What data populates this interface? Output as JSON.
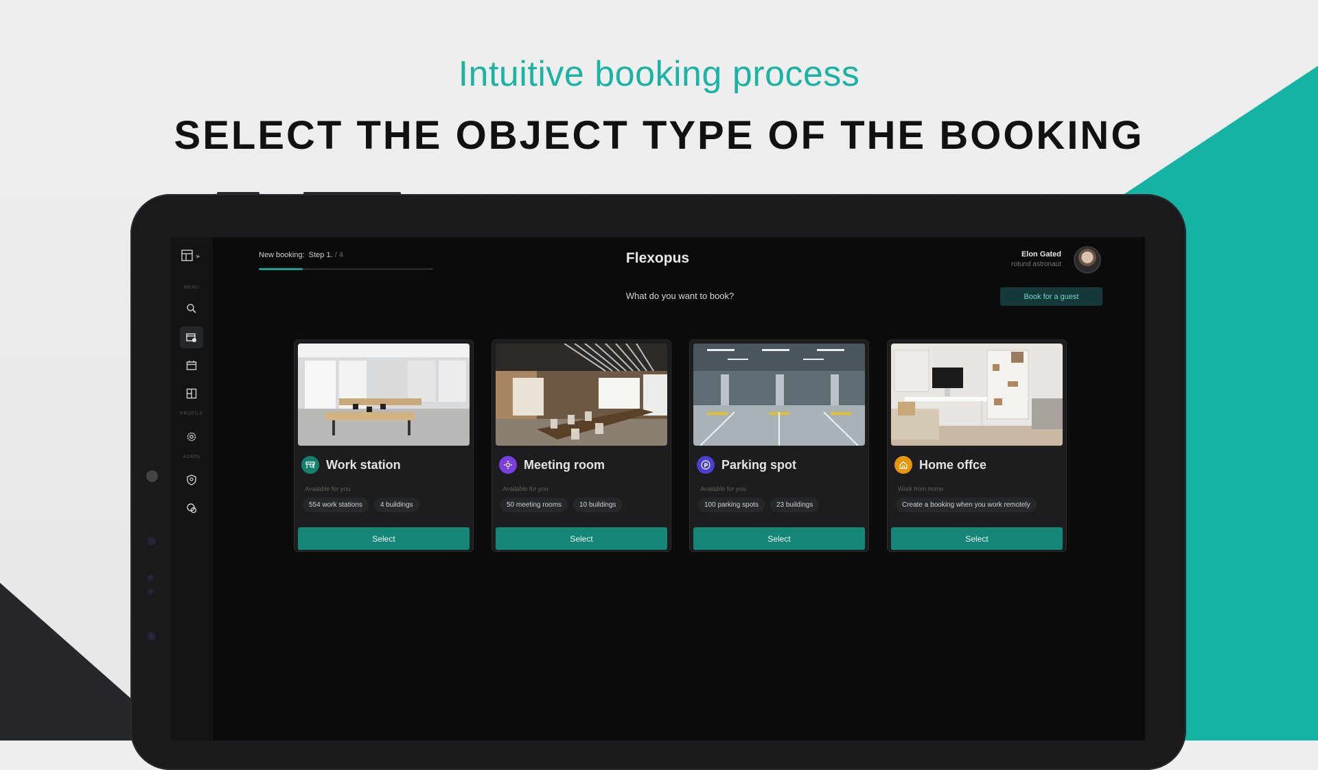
{
  "colors": {
    "accent": "#14b3a3",
    "button": "#168679",
    "background": "#0b0b0c"
  },
  "hero": {
    "subtitle": "Intuitive booking process",
    "title": "SELECT THE OBJECT TYPE OF THE BOOKING"
  },
  "app": {
    "brand": "Flexopus",
    "step": {
      "label": "New booking:",
      "current": "Step 1.",
      "separator": "/",
      "total": "4",
      "progress": 0.25
    },
    "user": {
      "name": "Elon Gated",
      "role": "rotund astronaut"
    },
    "question": "What do you want to book?",
    "guest_button": "Book for a guest",
    "sidebar": {
      "section_menu": "MENU",
      "section_profile": "PROFILE",
      "section_admin": "ADMIN",
      "icons": [
        "layout-icon",
        "search-icon",
        "booking-icon",
        "calendar-icon",
        "floorplan-icon",
        "settings-icon",
        "shield-icon",
        "support-icon"
      ]
    },
    "cards": [
      {
        "title": "Work station",
        "subtitle": "Available for you",
        "chips": [
          "554 work stations",
          "4 buildings"
        ],
        "button": "Select",
        "icon": "desk-icon",
        "icon_color": "#16806f"
      },
      {
        "title": "Meeting room",
        "subtitle": "Available for you",
        "chips": [
          "50 meeting rooms",
          "10 buildings"
        ],
        "button": "Select",
        "icon": "meeting-icon",
        "icon_color": "#7a3fe0"
      },
      {
        "title": "Parking spot",
        "subtitle": "Available for you",
        "chips": [
          "100 parking spots",
          "23 buildings"
        ],
        "button": "Select",
        "icon": "parking-icon",
        "icon_color": "#4a3fd0"
      },
      {
        "title": "Home offce",
        "subtitle": "Work from home",
        "chips": [
          "Create a booking when you work remotely"
        ],
        "button": "Select",
        "icon": "home-icon",
        "icon_color": "#e5960f"
      }
    ]
  }
}
